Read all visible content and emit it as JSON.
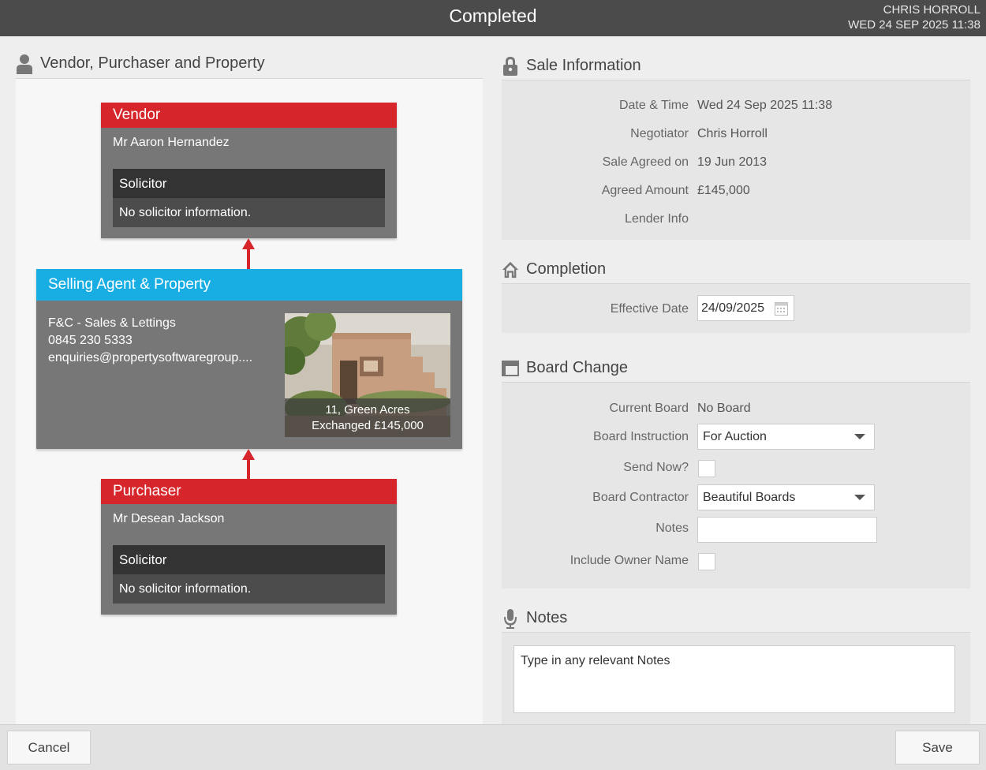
{
  "header": {
    "title": "Completed",
    "user_name": "CHRIS HORROLL",
    "datetime": "WED 24 SEP 2025 11:38"
  },
  "left_section": {
    "title": "Vendor, Purchaser and Property",
    "icon": "person-icon"
  },
  "vendor": {
    "title": "Vendor",
    "name": "Mr Aaron Hernandez",
    "solicitor_label": "Solicitor",
    "solicitor_info": "No solicitor information."
  },
  "agent": {
    "title": "Selling Agent & Property",
    "company": "F&C - Sales & Lettings",
    "phone": "0845 230 5333",
    "email": "enquiries@propertysoftwaregroup....",
    "property_address": "11, Green Acres",
    "property_status": "Exchanged £145,000"
  },
  "purchaser": {
    "title": "Purchaser",
    "name": "Mr Desean Jackson",
    "solicitor_label": "Solicitor",
    "solicitor_info": "No solicitor information."
  },
  "sale_info": {
    "title": "Sale Information",
    "icon": "lock-icon",
    "rows": [
      {
        "label": "Date & Time",
        "value": "Wed 24 Sep 2025 11:38"
      },
      {
        "label": "Negotiator",
        "value": "Chris Horroll"
      },
      {
        "label": "Sale Agreed on",
        "value": "19 Jun 2013"
      },
      {
        "label": "Agreed Amount",
        "value": "£145,000"
      },
      {
        "label": "Lender Info",
        "value": ""
      }
    ]
  },
  "completion": {
    "title": "Completion",
    "icon": "house-icon",
    "effective_date_label": "Effective Date",
    "effective_date_value": "24/09/2025"
  },
  "board_change": {
    "title": "Board Change",
    "icon": "board-icon",
    "current_board_label": "Current Board",
    "current_board_value": "No Board",
    "instruction_label": "Board Instruction",
    "instruction_value": "For Auction",
    "send_now_label": "Send Now?",
    "contractor_label": "Board Contractor",
    "contractor_value": "Beautiful Boards",
    "notes_label": "Notes",
    "include_owner_label": "Include Owner Name"
  },
  "notes": {
    "title": "Notes",
    "icon": "microphone-icon",
    "placeholder": "Type in any relevant Notes"
  },
  "footer": {
    "cancel_label": "Cancel",
    "save_label": "Save"
  },
  "colors": {
    "red": "#d7262b",
    "blue": "#19aee3",
    "topbar": "#4b4b4b"
  }
}
